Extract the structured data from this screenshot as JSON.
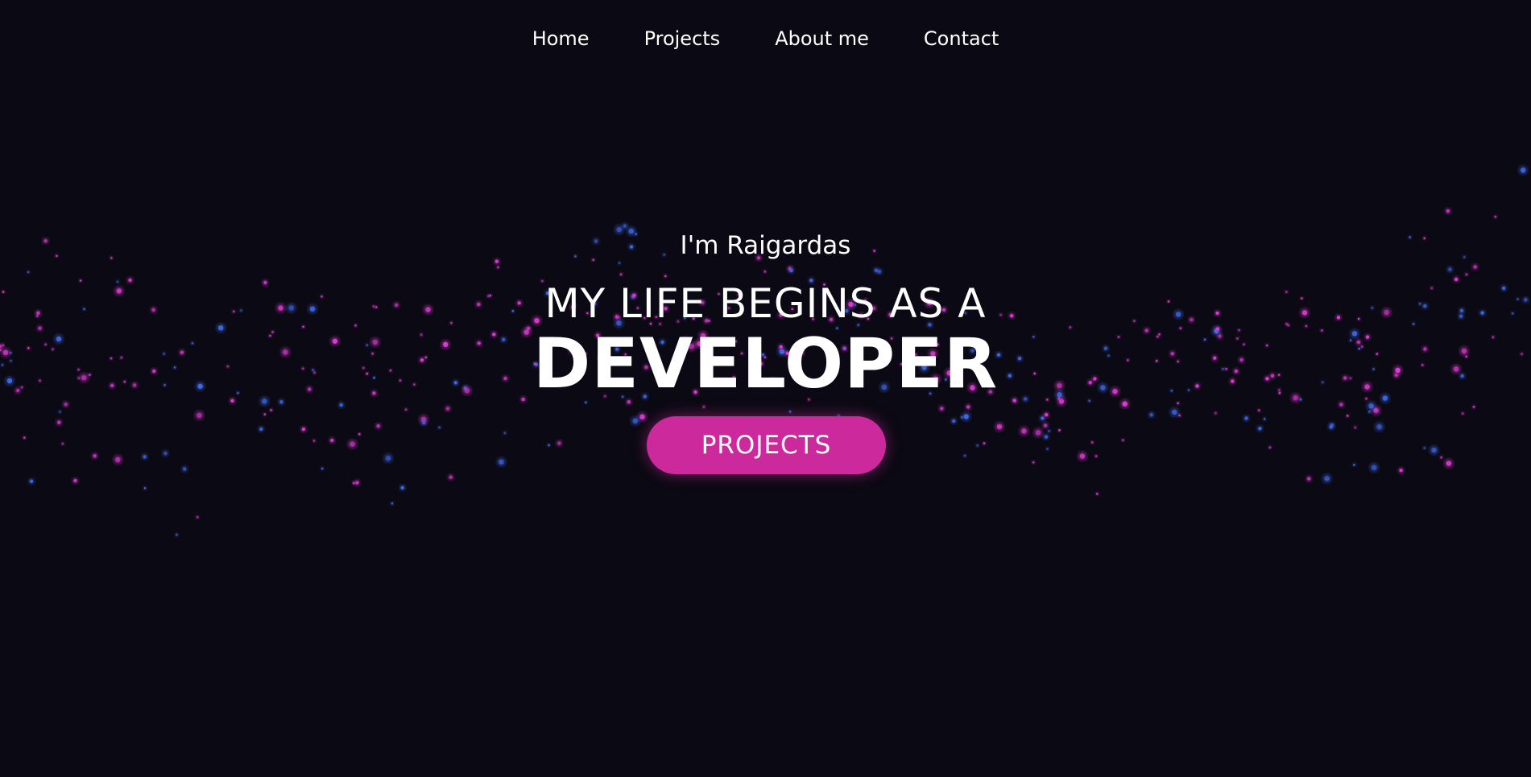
{
  "nav": {
    "items": [
      {
        "label": "Home"
      },
      {
        "label": "Projects"
      },
      {
        "label": "About me"
      },
      {
        "label": "Contact"
      }
    ]
  },
  "hero": {
    "intro": "I'm Raigardas",
    "headline": "MY LIFE BEGINS AS A",
    "title": "DEVELOPER",
    "button_label": "PROJECTS"
  },
  "colors": {
    "background": "#0b0913",
    "accent": "#cc2a9c",
    "particle_pink": "#e03ad6",
    "particle_blue": "#3f68e8",
    "text": "#ffffff"
  }
}
